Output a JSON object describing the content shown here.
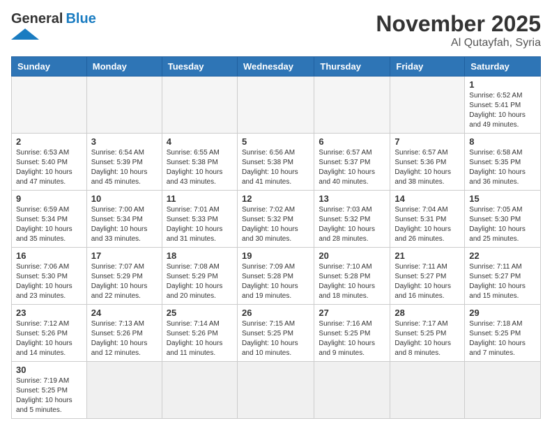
{
  "header": {
    "logo_general": "General",
    "logo_blue": "Blue",
    "month_title": "November 2025",
    "location": "Al Qutayfah, Syria"
  },
  "weekdays": [
    "Sunday",
    "Monday",
    "Tuesday",
    "Wednesday",
    "Thursday",
    "Friday",
    "Saturday"
  ],
  "days": [
    {
      "num": "",
      "info": ""
    },
    {
      "num": "",
      "info": ""
    },
    {
      "num": "",
      "info": ""
    },
    {
      "num": "",
      "info": ""
    },
    {
      "num": "",
      "info": ""
    },
    {
      "num": "",
      "info": ""
    },
    {
      "num": "1",
      "info": "Sunrise: 6:52 AM\nSunset: 5:41 PM\nDaylight: 10 hours\nand 49 minutes."
    },
    {
      "num": "2",
      "info": "Sunrise: 6:53 AM\nSunset: 5:40 PM\nDaylight: 10 hours\nand 47 minutes."
    },
    {
      "num": "3",
      "info": "Sunrise: 6:54 AM\nSunset: 5:39 PM\nDaylight: 10 hours\nand 45 minutes."
    },
    {
      "num": "4",
      "info": "Sunrise: 6:55 AM\nSunset: 5:38 PM\nDaylight: 10 hours\nand 43 minutes."
    },
    {
      "num": "5",
      "info": "Sunrise: 6:56 AM\nSunset: 5:38 PM\nDaylight: 10 hours\nand 41 minutes."
    },
    {
      "num": "6",
      "info": "Sunrise: 6:57 AM\nSunset: 5:37 PM\nDaylight: 10 hours\nand 40 minutes."
    },
    {
      "num": "7",
      "info": "Sunrise: 6:57 AM\nSunset: 5:36 PM\nDaylight: 10 hours\nand 38 minutes."
    },
    {
      "num": "8",
      "info": "Sunrise: 6:58 AM\nSunset: 5:35 PM\nDaylight: 10 hours\nand 36 minutes."
    },
    {
      "num": "9",
      "info": "Sunrise: 6:59 AM\nSunset: 5:34 PM\nDaylight: 10 hours\nand 35 minutes."
    },
    {
      "num": "10",
      "info": "Sunrise: 7:00 AM\nSunset: 5:34 PM\nDaylight: 10 hours\nand 33 minutes."
    },
    {
      "num": "11",
      "info": "Sunrise: 7:01 AM\nSunset: 5:33 PM\nDaylight: 10 hours\nand 31 minutes."
    },
    {
      "num": "12",
      "info": "Sunrise: 7:02 AM\nSunset: 5:32 PM\nDaylight: 10 hours\nand 30 minutes."
    },
    {
      "num": "13",
      "info": "Sunrise: 7:03 AM\nSunset: 5:32 PM\nDaylight: 10 hours\nand 28 minutes."
    },
    {
      "num": "14",
      "info": "Sunrise: 7:04 AM\nSunset: 5:31 PM\nDaylight: 10 hours\nand 26 minutes."
    },
    {
      "num": "15",
      "info": "Sunrise: 7:05 AM\nSunset: 5:30 PM\nDaylight: 10 hours\nand 25 minutes."
    },
    {
      "num": "16",
      "info": "Sunrise: 7:06 AM\nSunset: 5:30 PM\nDaylight: 10 hours\nand 23 minutes."
    },
    {
      "num": "17",
      "info": "Sunrise: 7:07 AM\nSunset: 5:29 PM\nDaylight: 10 hours\nand 22 minutes."
    },
    {
      "num": "18",
      "info": "Sunrise: 7:08 AM\nSunset: 5:29 PM\nDaylight: 10 hours\nand 20 minutes."
    },
    {
      "num": "19",
      "info": "Sunrise: 7:09 AM\nSunset: 5:28 PM\nDaylight: 10 hours\nand 19 minutes."
    },
    {
      "num": "20",
      "info": "Sunrise: 7:10 AM\nSunset: 5:28 PM\nDaylight: 10 hours\nand 18 minutes."
    },
    {
      "num": "21",
      "info": "Sunrise: 7:11 AM\nSunset: 5:27 PM\nDaylight: 10 hours\nand 16 minutes."
    },
    {
      "num": "22",
      "info": "Sunrise: 7:11 AM\nSunset: 5:27 PM\nDaylight: 10 hours\nand 15 minutes."
    },
    {
      "num": "23",
      "info": "Sunrise: 7:12 AM\nSunset: 5:26 PM\nDaylight: 10 hours\nand 14 minutes."
    },
    {
      "num": "24",
      "info": "Sunrise: 7:13 AM\nSunset: 5:26 PM\nDaylight: 10 hours\nand 12 minutes."
    },
    {
      "num": "25",
      "info": "Sunrise: 7:14 AM\nSunset: 5:26 PM\nDaylight: 10 hours\nand 11 minutes."
    },
    {
      "num": "26",
      "info": "Sunrise: 7:15 AM\nSunset: 5:25 PM\nDaylight: 10 hours\nand 10 minutes."
    },
    {
      "num": "27",
      "info": "Sunrise: 7:16 AM\nSunset: 5:25 PM\nDaylight: 10 hours\nand 9 minutes."
    },
    {
      "num": "28",
      "info": "Sunrise: 7:17 AM\nSunset: 5:25 PM\nDaylight: 10 hours\nand 8 minutes."
    },
    {
      "num": "29",
      "info": "Sunrise: 7:18 AM\nSunset: 5:25 PM\nDaylight: 10 hours\nand 7 minutes."
    },
    {
      "num": "30",
      "info": "Sunrise: 7:19 AM\nSunset: 5:25 PM\nDaylight: 10 hours\nand 5 minutes."
    }
  ]
}
